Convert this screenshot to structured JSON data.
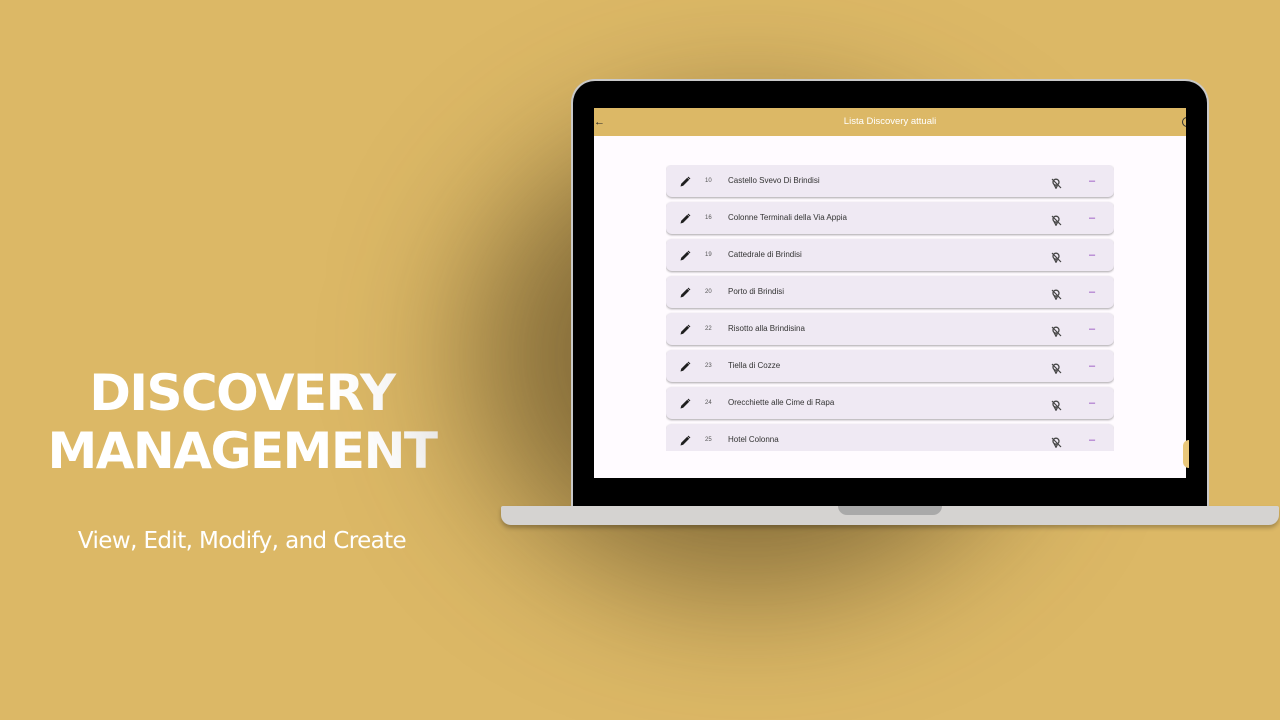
{
  "hero": {
    "title_line1": "DISCOVERY",
    "title_line2": "MANAGEMENT",
    "subtitle": "View, Edit, Modify, and Create"
  },
  "app": {
    "title": "Lista Discovery attuali",
    "back_icon": "arrow-left-icon",
    "action_icon": "circle-icon"
  },
  "colors": {
    "background": "#dcb866",
    "app_bar": "#dcb866",
    "row_background": "#efe9f3",
    "remove_accent": "#8a3ab9"
  },
  "discoveries": [
    {
      "id": "10",
      "name": "Castello Svevo Di Brindisi"
    },
    {
      "id": "16",
      "name": "Colonne Terminali della Via Appia"
    },
    {
      "id": "19",
      "name": "Cattedrale di Brindisi"
    },
    {
      "id": "20",
      "name": "Porto di Brindisi"
    },
    {
      "id": "22",
      "name": "Risotto alla Brindisina"
    },
    {
      "id": "23",
      "name": "Tiella di Cozze"
    },
    {
      "id": "24",
      "name": "Orecchiette alle Cime di Rapa"
    },
    {
      "id": "25",
      "name": "Hotel Colonna"
    }
  ],
  "row_icons": {
    "edit": "pencil-icon",
    "location": "location-off-icon",
    "remove": "minus-icon"
  }
}
